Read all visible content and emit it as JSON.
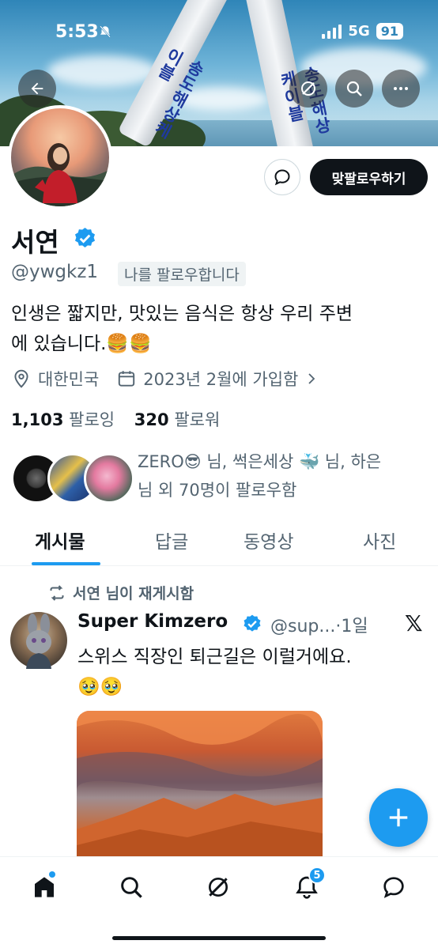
{
  "status_bar": {
    "time": "5:53",
    "network": "5G",
    "battery": "91"
  },
  "banner": {
    "sign_left": "송도해상케이블",
    "sign_right": "송도해상케이블"
  },
  "profile": {
    "name": "서연",
    "handle": "@ywgkz1",
    "follows_you": "나를 팔로우합니다",
    "follow_button": "맞팔로우하기",
    "bio_line1": "인생은 짧지만, 맛있는 음식은 항상 우리 주변",
    "bio_line2": "에 있습니다.🍔🍔",
    "location": "대한민국",
    "joined": "2023년 2월에 가입함",
    "following_count": "1,103",
    "following_label": "팔로잉",
    "followers_count": "320",
    "followers_label": "팔로워",
    "mutuals_line1": "ZERO😎 님, 썩은세상 🐳 님, 하은",
    "mutuals_line2": "님 외 70명이 팔로우함"
  },
  "tabs": [
    {
      "label": "게시물"
    },
    {
      "label": "답글"
    },
    {
      "label": "동영상"
    },
    {
      "label": "사진"
    }
  ],
  "post": {
    "repost_text": "서연 님이 재게시함",
    "author_name": "Super Kimzero",
    "author_handle": "@sup...",
    "time": "·1일",
    "text_line1": "스위스 직장인 퇴근길은 이럴거에요.",
    "text_line2": "🥹🥹"
  },
  "bottom_nav": {
    "notification_count": "5"
  },
  "colors": {
    "accent": "#1d9bf0",
    "text": "#0f1419",
    "secondary": "#536471"
  }
}
